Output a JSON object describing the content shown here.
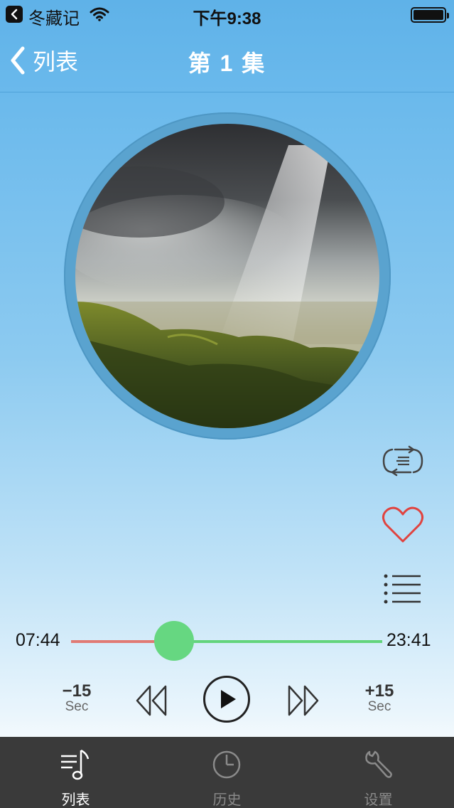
{
  "status_bar": {
    "app_name": "冬藏记",
    "time": "下午9:38"
  },
  "nav": {
    "back_label": "列表",
    "title": "第 1 集"
  },
  "player": {
    "elapsed": "07:44",
    "total": "23:41",
    "progress": 0.33,
    "rewind": {
      "amount": "−15",
      "unit": "Sec"
    },
    "forward": {
      "amount": "+15",
      "unit": "Sec"
    }
  },
  "side_actions": {
    "repeat_icon": "repeat-icon",
    "favorite_icon": "heart-icon",
    "playlist_icon": "playlist-icon"
  },
  "tabs": [
    {
      "label": "列表",
      "icon": "music-list-icon",
      "active": true
    },
    {
      "label": "历史",
      "icon": "clock-icon",
      "active": false
    },
    {
      "label": "设置",
      "icon": "wrench-icon",
      "active": false
    }
  ],
  "colors": {
    "played": "#e07a74",
    "remaining": "#63d47c",
    "favorite": "#e0433f",
    "tab_bar": "#3a3a3a"
  }
}
